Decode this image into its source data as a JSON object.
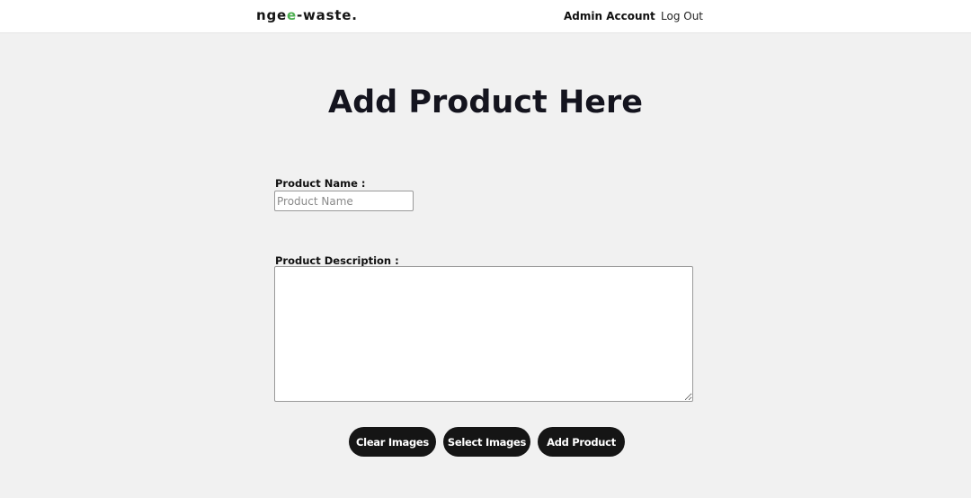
{
  "nav": {
    "logo_prefix": "nge",
    "logo_accent": "e",
    "logo_suffix": "-waste.",
    "admin_label": "Admin Account",
    "logout_label": "Log Out"
  },
  "page": {
    "title": "Add Product Here"
  },
  "form": {
    "name_label": "Product Name :",
    "name_placeholder": "Product Name",
    "name_value": "",
    "description_label": "Product Description :",
    "description_value": ""
  },
  "buttons": {
    "clear_images": "Clear Images",
    "select_images": "Select Images",
    "add_product": "Add Product"
  },
  "colors": {
    "logo_accent": "#4caf50",
    "button_bg": "#151515",
    "page_bg": "#f1f1f1"
  }
}
